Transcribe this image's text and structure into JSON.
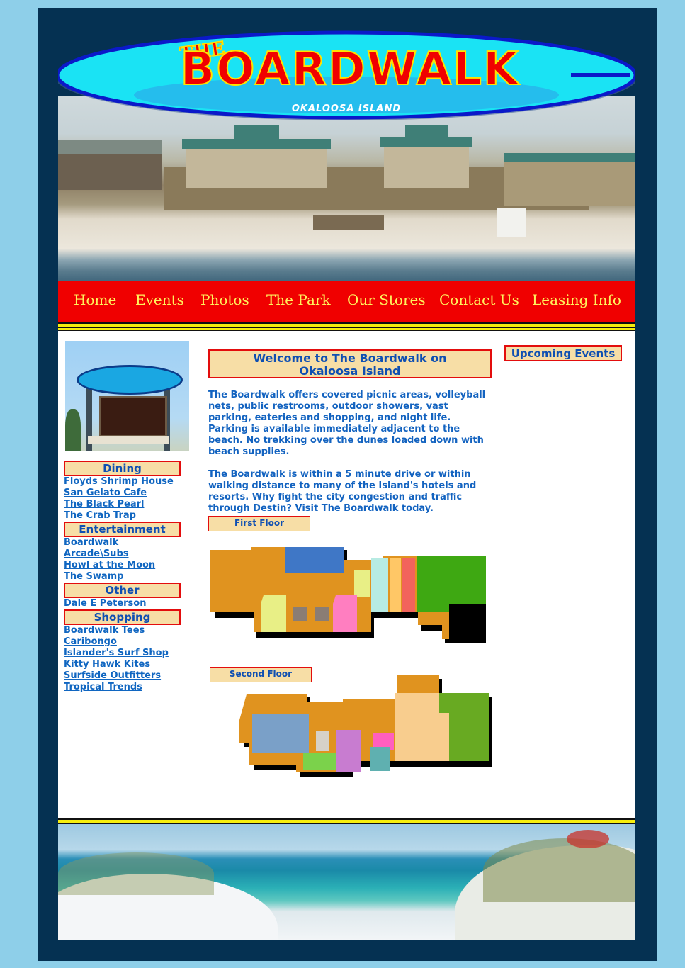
{
  "logo": {
    "title": "BOARDWALK",
    "the": "THE",
    "subtitle": "OKALOOSA ISLAND"
  },
  "nav": {
    "items": [
      "Home",
      "Events",
      "Photos",
      "The Park",
      "Our Stores",
      "Contact Us",
      "Leasing Info"
    ]
  },
  "sidebar": {
    "sign_image": "boardwalk-sign-photo",
    "sections": [
      {
        "title": "Dining",
        "links": [
          "Floyds Shrimp House",
          "San Gelato Cafe",
          "The Black Pearl",
          "The Crab Trap"
        ]
      },
      {
        "title": "Entertainment",
        "links": [
          "Boardwalk",
          "Arcade\\Subs",
          "Howl at the Moon",
          "The Swamp"
        ]
      },
      {
        "title": "Other",
        "links": [
          "Dale E Peterson"
        ]
      },
      {
        "title": "Shopping",
        "links": [
          "Boardwalk Tees",
          "Caribongo",
          "Islander's Surf Shop",
          "Kitty Hawk Kites",
          "Surfside Outfitters",
          "Tropical Trends"
        ]
      }
    ]
  },
  "main": {
    "welcome_title": "Welcome to The Boardwalk on Okaloosa Island",
    "para1": "The Boardwalk offers covered picnic areas, volleyball nets, public restrooms, outdoor showers, vast parking, eateries and shopping, and night life. Parking is available immediately adjacent to the beach. No trekking over the dunes loaded down with beach supplies.",
    "para2": "The Boardwalk is within a 5 minute drive or within walking distance to many of the Island's hotels and resorts. Why fight the city congestion and traffic through Destin? Visit The Boardwalk today.",
    "first_floor_label": "First Floor",
    "second_floor_label": "Second Floor"
  },
  "right": {
    "events_title": "Upcoming Events"
  },
  "colors": {
    "frame": "#053152",
    "background": "#8ecfe9",
    "nav": "#f00000",
    "nav_text": "#fff25c",
    "link": "#1066c1",
    "header_box": "#f7dea6",
    "box_border": "#e30d0d"
  }
}
